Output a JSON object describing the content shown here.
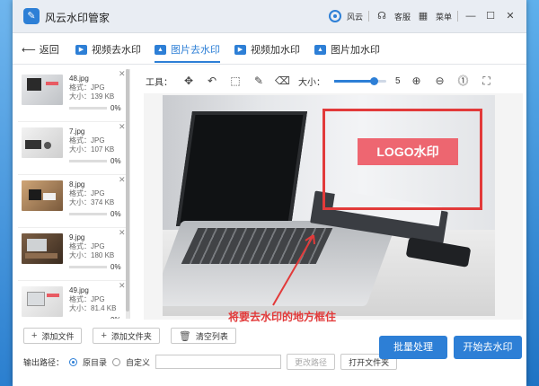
{
  "app": {
    "title": "风云水印管家",
    "user_label": "风云",
    "service_label": "客服",
    "menu_label": "菜单"
  },
  "nav": {
    "back_label": "返回",
    "tabs": [
      {
        "label": "视频去水印",
        "active": false
      },
      {
        "label": "图片去水印",
        "active": true
      },
      {
        "label": "视频加水印",
        "active": false
      },
      {
        "label": "图片加水印",
        "active": false
      }
    ]
  },
  "files": [
    {
      "name": "48.jpg",
      "format_label": "格式：JPG",
      "size_label": "大小：139 KB",
      "progress": "0%"
    },
    {
      "name": "7.jpg",
      "format_label": "格式：JPG",
      "size_label": "大小：107 KB",
      "progress": "0%"
    },
    {
      "name": "8.jpg",
      "format_label": "格式：JPG",
      "size_label": "大小：374 KB",
      "progress": "0%"
    },
    {
      "name": "9.jpg",
      "format_label": "格式：JPG",
      "size_label": "大小：180 KB",
      "progress": "0%"
    },
    {
      "name": "49.jpg",
      "format_label": "格式：JPG",
      "size_label": "大小：81.4 KB",
      "progress": "0%"
    }
  ],
  "toolbar": {
    "tools_label": "工具：",
    "size_label": "大小：",
    "size_value": "5"
  },
  "canvas": {
    "watermark_text": "LOGO水印",
    "annotation": "将要去水印的地方框住"
  },
  "actions": {
    "add_file": "添加文件",
    "add_folder": "添加文件夹",
    "clear_list": "清空列表",
    "batch": "批量处理",
    "start": "开始去水印"
  },
  "output": {
    "label": "输出路径：",
    "option_original": "原目录",
    "option_custom": "自定义",
    "change_path": "更改路径",
    "open_folder": "打开文件夹"
  },
  "colors": {
    "accent": "#2d7fd6",
    "annotation_red": "#e23a3a"
  }
}
